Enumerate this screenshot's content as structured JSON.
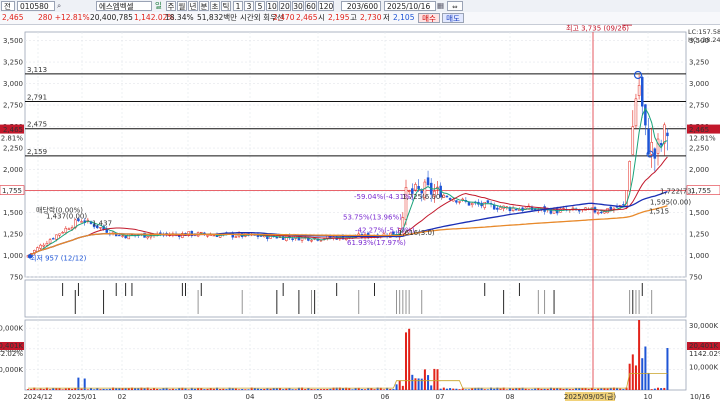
{
  "toolbar": {
    "market": "전",
    "code": "010580",
    "name": "에스엠벡셀",
    "price": "2,465",
    "change": "280 +12.81%",
    "volume": "20,400,785",
    "volume_pct": "1,142.02%",
    "turnover": "18.34%",
    "amount": "51,832백만",
    "ext_label": "시간외 회우선",
    "open_label": "시",
    "open": "2,195",
    "high_label": "고",
    "high": "2,730",
    "low_label": "저",
    "low": "2,105",
    "prev": "2,470",
    "prev2": "2,465",
    "buy": "매수",
    "sell": "매도",
    "periods": [
      "주",
      "월",
      "년",
      "분",
      "초",
      "틱"
    ],
    "intervals": [
      "1",
      "3",
      "5",
      "10",
      "20",
      "30",
      "60",
      "120"
    ],
    "count": "203/600",
    "date": "2025/10/16"
  },
  "colors": {
    "up": "#e2231a",
    "down": "#1e55d6",
    "ma5": "#1aa37a",
    "ma20": "#c2182b",
    "ma60": "#1a2fb5",
    "ma120": "#e8892a",
    "hline": "#111111",
    "crosshair": "#e0303a"
  },
  "price_axis": {
    "ticks": [
      "3,500",
      "3,250",
      "3,000",
      "2,750",
      "2,500",
      "2,250",
      "2,000",
      "1,750",
      "1,500",
      "1,250",
      "1,000",
      "750"
    ],
    "right_ticks": [
      "3,500",
      "3,250",
      "3,000",
      "2,750",
      "2,500",
      "2,250",
      "2,000",
      "1,750",
      "1,500",
      "1,250",
      "1,000",
      "750"
    ],
    "current_label": "2,465",
    "current_pct": "12.81%",
    "cross_label": "1,755",
    "lc": "LC:157.58",
    "hc": "HC:-28.24"
  },
  "hlines": [
    {
      "label": "3,113",
      "value": 3113
    },
    {
      "label": "2,791",
      "value": 2791
    },
    {
      "label": "2,475",
      "value": 2475
    },
    {
      "label": "2,159",
      "value": 2159
    }
  ],
  "annotations": {
    "high": "최고 3,735 (09/26)",
    "low": "최저 957 (12/12)",
    "a1": "매당락(0.00%)",
    "a2": "1,437(0.00)",
    "a3": "1,437",
    "a4": "-59.04%(-4.31%)",
    "a5": "1,725(6.00)",
    "a6": "53.75%(13.96%)",
    "a7": "-42.27%(-5.19%)",
    "a8": "1,616(3.0)",
    "a9": "61.93%(17.97%)",
    "a10": "1,722(73)",
    "a11": "1,595(0.00)",
    "a12": "1,515"
  },
  "volume_axis": {
    "ticks": [
      "30,000K",
      "20,000K",
      "10,000K"
    ],
    "right_ticks": [
      "30,000K",
      "20,401K",
      "1142.02%",
      "10,000K"
    ],
    "left_extra": [
      "20,401K",
      "1142.02%"
    ]
  },
  "x_axis": {
    "labels": [
      "2024/12",
      "2025/01",
      "02",
      "03",
      "04",
      "05",
      "06",
      "07",
      "08",
      "2025/09/05(금)",
      "10",
      "10/16"
    ]
  },
  "chart_data": {
    "type": "candlestick",
    "x": [
      "2024-12",
      "2025-01",
      "2025-02",
      "2025-03",
      "2025-04",
      "2025-05",
      "2025-06",
      "2025-07",
      "2025-08",
      "2025-09",
      "2025-10"
    ],
    "close_approx": [
      1000,
      1420,
      1230,
      1250,
      1230,
      1200,
      1650,
      1720,
      1530,
      1620,
      2465
    ],
    "ylim": [
      750,
      3600
    ],
    "high": 3735,
    "low": 957,
    "volume_ylim": [
      0,
      34000
    ],
    "volume_unit": "K"
  }
}
